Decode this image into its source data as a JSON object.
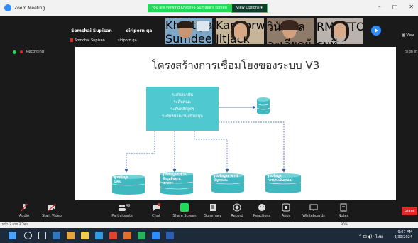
{
  "window": {
    "app_name": "Zoom Meeting",
    "controls": [
      "–",
      "□",
      "✕"
    ]
  },
  "banner": {
    "viewing_text": "You are viewing Khattiya Sumdee's screen",
    "options_label": "View Options",
    "chevron": "▾"
  },
  "gallery": {
    "view_label": "▦ View",
    "participants": [
      {
        "name": "Somchai Supisan",
        "caption": "Somchai Supisan",
        "video": false
      },
      {
        "name": "siriporn qa",
        "caption": "siriporn qa",
        "video": false
      },
      {
        "name": "",
        "caption": "Khattiya Sumdee",
        "video": true
      },
      {
        "name": "",
        "caption": "Kanhorwan Jitjack",
        "video": true
      },
      {
        "name": "",
        "caption": "วินัย กุลละเอียดผู้หลัก...",
        "video": true
      },
      {
        "name": "",
        "caption": "RMUTTO+ทรรมที",
        "video": true
      }
    ]
  },
  "recording": {
    "label": "Recording"
  },
  "signin": {
    "label": "Sign in"
  },
  "slide": {
    "title": "โครงสร้างการเชื่อมโยงของระบบ V3",
    "main_box_lines": [
      "ระดับสถาบัน",
      "ระดับคณะ",
      "ระดับหลักสูตร",
      "ระดับหน่วยงานสนับสนุน"
    ],
    "databases": [
      {
        "lines": [
          "ฐานข้อมูล",
          "มคอ."
        ]
      },
      {
        "lines": [
          "ฐานข้อมูลตัวชี้วัด",
          "ข้อมูลพื้นฐาน",
          "เอกสาร"
        ]
      },
      {
        "lines": [
          "ฐานข้อมูลอาจารย์",
          "ปัญหาและ"
        ]
      },
      {
        "lines": [
          "ฐานข้อมูล",
          "การประเมินตนเอง"
        ]
      }
    ]
  },
  "toolbar": {
    "items": [
      {
        "label": "Audio",
        "icon": "microphone-icon"
      },
      {
        "label": "Start Video",
        "icon": "video-off-icon"
      },
      {
        "label": "Participants",
        "icon": "participants-icon",
        "count": "49"
      },
      {
        "label": "Chat",
        "icon": "chat-icon"
      },
      {
        "label": "Share Screen",
        "icon": "share-screen-icon"
      },
      {
        "label": "Summary",
        "icon": "summary-icon"
      },
      {
        "label": "Record",
        "icon": "record-icon"
      },
      {
        "label": "Reactions",
        "icon": "reactions-icon"
      },
      {
        "label": "Apps",
        "icon": "apps-icon"
      },
      {
        "label": "Whiteboards",
        "icon": "whiteboard-icon"
      },
      {
        "label": "Notes",
        "icon": "notes-icon"
      }
    ],
    "leave_label": "Leave"
  },
  "status_bar": {
    "left": "หน้า 3 จาก 3   ไทย",
    "zoom": "90%"
  },
  "taskbar": {
    "time": "9:07 AM",
    "date": "4/30/2024",
    "lang": "ไทย"
  },
  "colors": {
    "slide_box": "#4fc9cf",
    "db": "#3fb8bf",
    "share_green": "#23d959",
    "leave_red": "#e02828",
    "zoom_blue": "#2d8cff"
  }
}
